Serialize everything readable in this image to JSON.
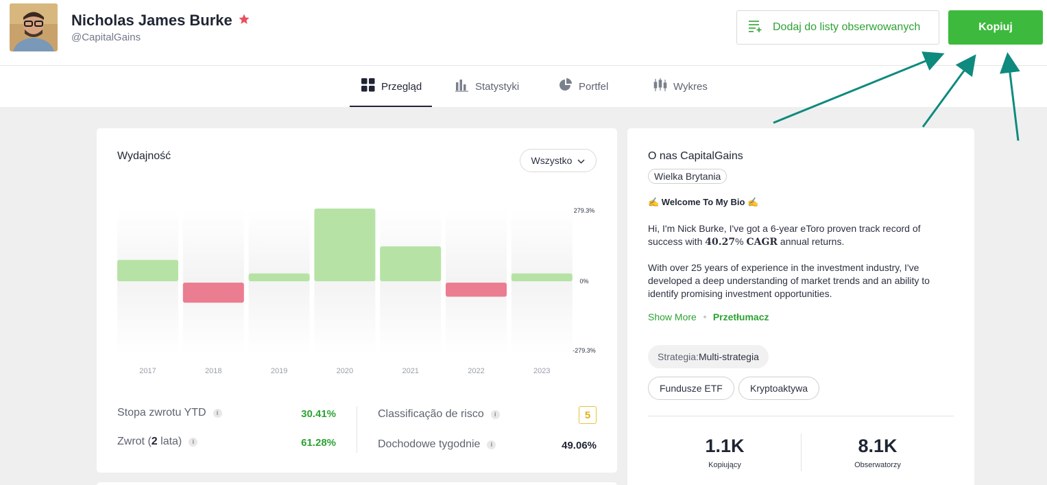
{
  "header": {
    "name": "Nicholas James Burke",
    "handle": "@CapitalGains",
    "watchlist_label": "Dodaj do listy obserwowanych",
    "copy_label": "Kopiuj"
  },
  "tabs": [
    {
      "label": "Przegląd",
      "icon": "grid-icon",
      "active": true
    },
    {
      "label": "Statystyki",
      "icon": "bar-chart-icon",
      "active": false
    },
    {
      "label": "Portfel",
      "icon": "pie-chart-icon",
      "active": false
    },
    {
      "label": "Wykres",
      "icon": "candlestick-icon",
      "active": false
    }
  ],
  "performance": {
    "title": "Wydajność",
    "filter": "Wszystko"
  },
  "chart_data": {
    "type": "bar",
    "categories": [
      "2017",
      "2018",
      "2019",
      "2020",
      "2021",
      "2022",
      "2023"
    ],
    "values": [
      82,
      -77,
      30,
      279.3,
      134,
      -54,
      30
    ],
    "ylim": [
      -279.3,
      279.3
    ],
    "ytick_labels": [
      "279.3%",
      "0%",
      "-279.3%"
    ],
    "positive_color": "#b6e3a5",
    "negative_color": "#eb7d91"
  },
  "stats": {
    "ytd_label": "Stopa zwrotu YTD",
    "ytd_value": "30.41%",
    "return_prefix": "Zwrot (",
    "return_years": "2",
    "return_suffix": " lata)",
    "return_value": "61.28%",
    "risk_label": "Classificação de risco",
    "risk_value": "5",
    "weekly_label": "Dochodowe tygodnie",
    "weekly_value": "49.06%"
  },
  "about": {
    "title": "O nas CapitalGains",
    "country": "Wielka Brytania",
    "bio_head": "✍️ Welcome To My Bio ✍️",
    "bio_p1_a": "Hi, I'm Nick Burke, I've got a 6-year eToro proven track record of success with ",
    "bio_p1_b": "40.27",
    "bio_p1_c": "% ",
    "bio_p1_d": "CAGR",
    "bio_p1_e": " annual returns.",
    "bio_p2": "With over 25 years of experience in the investment industry, I've developed a deep understanding of market trends and an ability to identify promising investment opportunities.",
    "show_more": "Show More",
    "translate": "Przetłumacz",
    "strategy_label": "Strategia:",
    "strategy_value": "Multi-strategia",
    "tag1": "Fundusze ETF",
    "tag2": "Kryptoaktywa",
    "copiers_value": "1.1K",
    "copiers_label": "Kopiujący",
    "watchers_value": "8.1K",
    "watchers_label": "Obserwatorzy"
  },
  "colors": {
    "brand_green": "#3dba3d",
    "text_green": "#2da233",
    "annotation_arrow": "#0e8a7e",
    "risk_yellow": "#e0b21a"
  }
}
